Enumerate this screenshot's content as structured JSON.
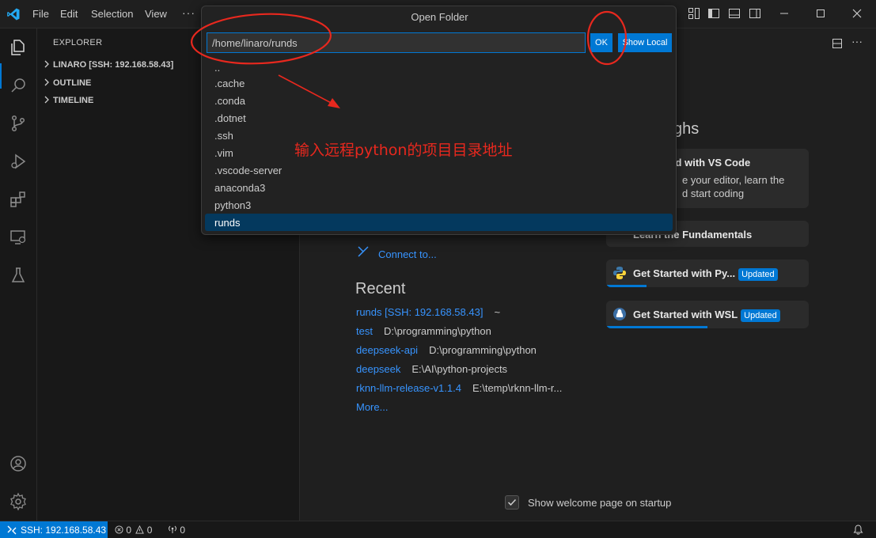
{
  "menu": {
    "file": "File",
    "edit": "Edit",
    "selection": "Selection",
    "view": "View",
    "more": "···"
  },
  "sidebar": {
    "title": "EXPLORER",
    "sections": [
      {
        "label": "LINARO [SSH: 192.168.58.43]"
      },
      {
        "label": "OUTLINE"
      },
      {
        "label": "TIMELINE"
      }
    ]
  },
  "quickpick": {
    "title": "Open Folder",
    "input_value": "/home/linaro/runds",
    "ok_label": "OK",
    "show_local_label": "Show Local",
    "items": [
      "..",
      ".cache",
      ".conda",
      ".dotnet",
      ".ssh",
      ".vim",
      ".vscode-server",
      "anaconda3",
      "python3",
      "runds"
    ],
    "selected_index": 9
  },
  "annotation": {
    "text": "输入远程python的项目目录地址",
    "color": "#e8281e"
  },
  "welcome": {
    "connect_label": "Connect to...",
    "recent_title": "Recent",
    "recent": [
      {
        "name": "runds [SSH: 192.168.58.43]",
        "path": "~"
      },
      {
        "name": "test",
        "path": "D:\\programming\\python"
      },
      {
        "name": "deepseek-api",
        "path": "D:\\programming\\python"
      },
      {
        "name": "deepseek",
        "path": "E:\\AI\\python-projects"
      },
      {
        "name": "rknn-llm-release-v1.1.4",
        "path": "E:\\temp\\rknn-llm-r..."
      }
    ],
    "more_label": "More...",
    "walkthroughs_title": "ghs",
    "cards": [
      {
        "title": "ted with VS Code",
        "desc1": "e your editor, learn the",
        "desc2": "d start coding",
        "progress": 0
      },
      {
        "title": "Learn the Fundamentals",
        "progress": 0
      },
      {
        "title": "Get Started with Py...",
        "badge": "Updated",
        "progress": 0.2
      },
      {
        "title": "Get Started with WSL",
        "badge": "Updated",
        "progress": 0.5
      }
    ],
    "show_on_startup_label": "Show welcome page on startup",
    "show_on_startup_checked": true
  },
  "statusbar": {
    "remote": "SSH: 192.168.58.43",
    "errors": "0",
    "warnings": "0",
    "ports": "0"
  },
  "colors": {
    "accent": "#0078d4",
    "link": "#3794ff",
    "annotation": "#e8281e"
  }
}
